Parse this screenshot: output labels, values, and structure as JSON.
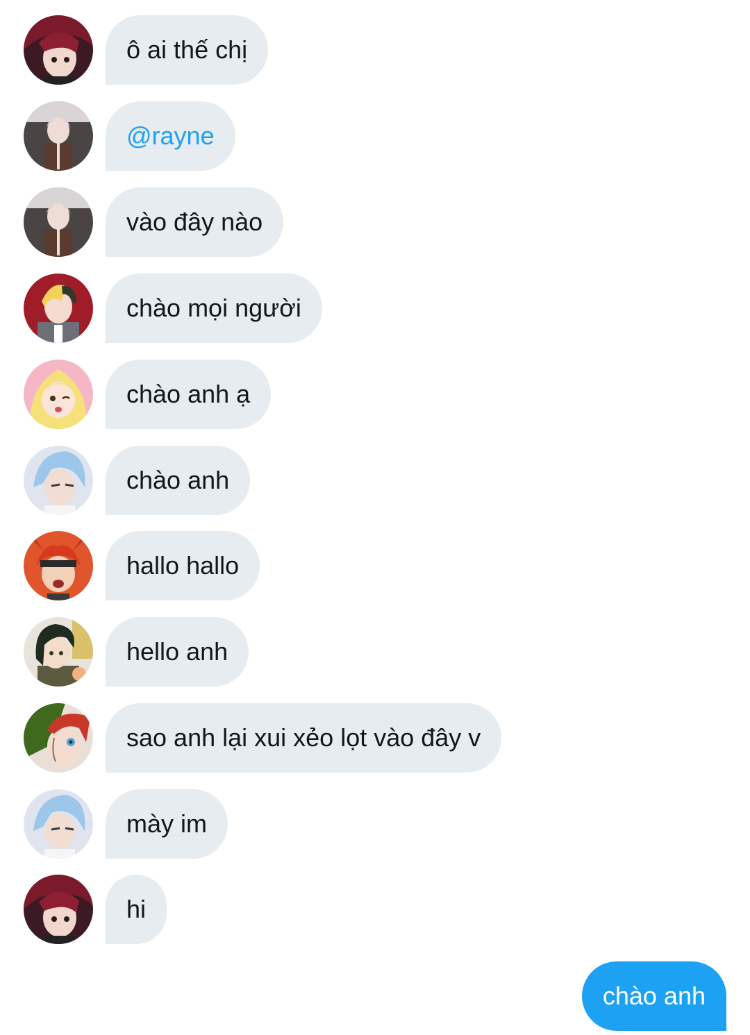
{
  "thread": {
    "messages": [
      {
        "text": "ô ai thế chị",
        "direction": "received",
        "avatar": "avatar-red-hair-icon"
      },
      {
        "text": "@rayne",
        "direction": "received",
        "avatar": "avatar-silver-hair-icon",
        "is_mention": true
      },
      {
        "text": "vào đây nào",
        "direction": "received",
        "avatar": "avatar-silver-hair-icon"
      },
      {
        "text": "chào mọi người",
        "direction": "received",
        "avatar": "avatar-blonde-green-hair-icon"
      },
      {
        "text": "chào anh ạ",
        "direction": "received",
        "avatar": "avatar-blonde-girl-icon"
      },
      {
        "text": "chào anh",
        "direction": "received",
        "avatar": "avatar-blue-hair-icon"
      },
      {
        "text": "hallo hallo",
        "direction": "received",
        "avatar": "avatar-orange-hair-headband-icon"
      },
      {
        "text": "hello anh",
        "direction": "received",
        "avatar": "avatar-dark-hair-icon"
      },
      {
        "text": "sao anh lại xui xẻo lọt vào đây v",
        "direction": "received",
        "avatar": "avatar-red-green-hair-icon"
      },
      {
        "text": "mày im",
        "direction": "received",
        "avatar": "avatar-blue-hair-icon"
      },
      {
        "text": "hi",
        "direction": "received",
        "avatar": "avatar-red-hair-icon"
      },
      {
        "text": "chào anh",
        "direction": "sent"
      }
    ]
  },
  "colors": {
    "received_bubble": "#e6ecf0",
    "received_text": "#14171a",
    "sent_bubble": "#1da1f2",
    "sent_text": "#ffffff",
    "mention": "#1da1f2"
  }
}
